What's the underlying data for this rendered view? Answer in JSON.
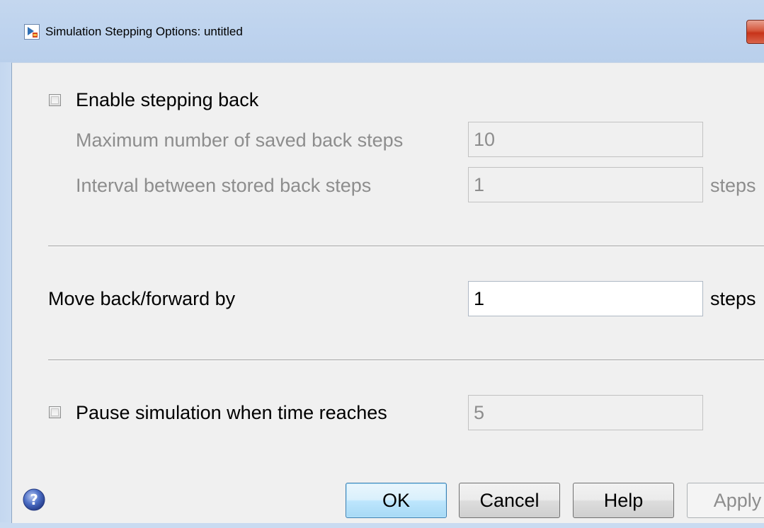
{
  "window": {
    "title": "Simulation Stepping Options: untitled",
    "app_icon": "simulink-model-icon",
    "close_icon": "close-icon"
  },
  "stepping_back": {
    "enable_label": "Enable stepping back",
    "enable_checked": false,
    "max_steps_label": "Maximum number of saved back steps",
    "max_steps_value": "10",
    "interval_label": "Interval between stored back steps",
    "interval_value": "1",
    "interval_unit": "steps"
  },
  "move": {
    "label": "Move back/forward by",
    "value": "1",
    "unit": "steps"
  },
  "pause": {
    "label": "Pause simulation when time reaches",
    "checked": false,
    "value": "5"
  },
  "buttons": {
    "ok": "OK",
    "cancel": "Cancel",
    "help": "Help",
    "apply": "Apply",
    "help_icon": "question-circle-icon"
  },
  "colors": {
    "accent_default_button": "#3c7fb1",
    "disabled_text": "#8d8d8d",
    "dialog_background": "#f0f0f0"
  }
}
